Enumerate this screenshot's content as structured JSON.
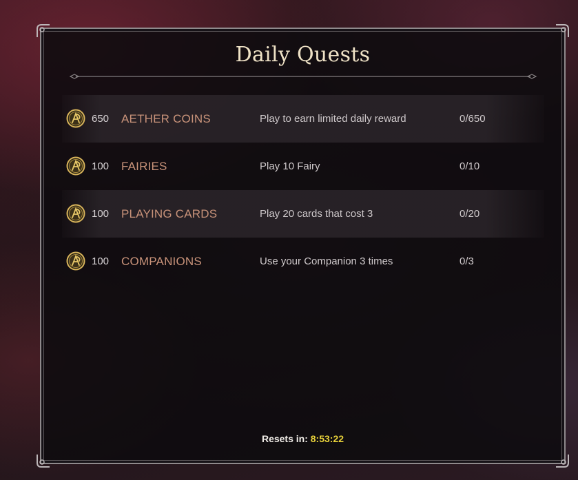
{
  "title": "Daily Quests",
  "quests": [
    {
      "reward": "650",
      "name": "AETHER COINS",
      "description": "Play to earn limited daily reward",
      "progress": "0/650"
    },
    {
      "reward": "100",
      "name": "FAIRIES",
      "description": "Play 10 Fairy",
      "progress": "0/10"
    },
    {
      "reward": "100",
      "name": "PLAYING CARDS",
      "description": "Play 20 cards that cost 3",
      "progress": "0/20"
    },
    {
      "reward": "100",
      "name": "COMPANIONS",
      "description": "Use your Companion 3 times",
      "progress": "0/3"
    }
  ],
  "reset": {
    "label": "Resets in:",
    "time": "8:53:22"
  },
  "icons": {
    "reward": "aether-coin-icon"
  },
  "colors": {
    "quest_name": "#c9937a",
    "timer": "#e8d23a",
    "title": "#efe2c6"
  }
}
